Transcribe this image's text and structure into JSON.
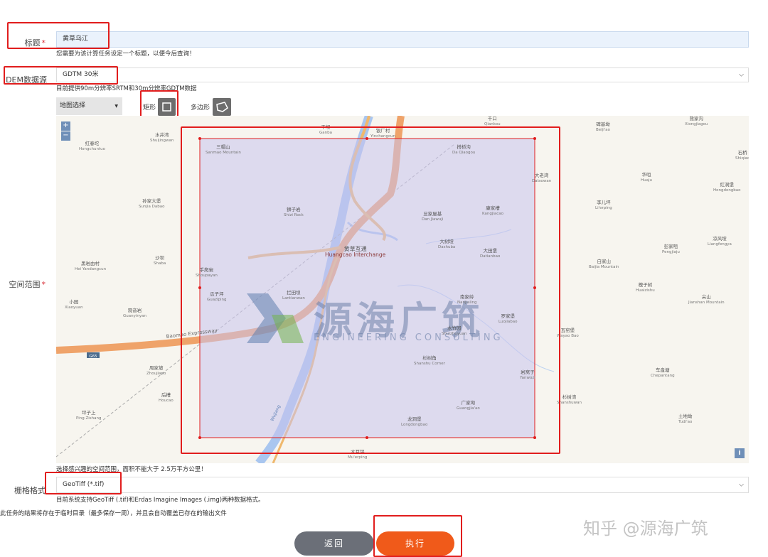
{
  "form": {
    "title": {
      "label": "标题",
      "value": "黄草乌江",
      "hint": "您需要为该计算任务设定一个标题，以便今后查询！"
    },
    "dem": {
      "label": "DEM数据源",
      "value": "GDTM 30米",
      "hint": "目前提供90m分辨率SRTM和30m分辨率GDTM数据"
    },
    "space": {
      "label": "空间范围",
      "hint": "选择感兴趣的空间范围，面积不能大于 2.5万平方公里！"
    },
    "raster": {
      "label": "栅格格式",
      "value": "GeoTiff (*.tif)",
      "hint": "目前系统支持GeoTiff (.tif)和Erdas Imagine Images (.img)两种数据格式。"
    },
    "note": "此任务的结果将存在于临时目录（最多保存一周），并且会自动覆盖已存在的输出文件"
  },
  "map_tools": {
    "basemap_select": "地图选择",
    "rect_label": "矩形",
    "polygon_label": "多边形",
    "zoom_in": "+",
    "zoom_out": "−",
    "info": "i"
  },
  "map_places": [
    {
      "zh": "干坝",
      "en": "Ganba"
    },
    {
      "zh": "银厂村",
      "en": "Yinchangcun"
    },
    {
      "zh": "千口",
      "en": "Qiankou"
    },
    {
      "zh": "碑基坳",
      "en": "Beiji'ao"
    },
    {
      "zh": "熊家沟",
      "en": "Xiongjiagou"
    },
    {
      "zh": "石桥",
      "en": "Shiqiao"
    },
    {
      "zh": "红春坨",
      "en": "Hongchuntuo"
    },
    {
      "zh": "水井湾",
      "en": "Shuijingwan"
    },
    {
      "zh": "三帽山",
      "en": "Sanmao Mountain"
    },
    {
      "zh": "搭桥沟",
      "en": "Da Qiaogou"
    },
    {
      "zh": "大老湾",
      "en": "Dalaowan"
    },
    {
      "zh": "华咀",
      "en": "Huaju"
    },
    {
      "zh": "红洞堡",
      "en": "Hongdongbao"
    },
    {
      "zh": "孙家大堡",
      "en": "Sunjia Dabao"
    },
    {
      "zh": "狮子岩",
      "en": "Shizi Rock"
    },
    {
      "zh": "旦家屋基",
      "en": "Dan Jiawuji"
    },
    {
      "zh": "康家槽",
      "en": "Kangjiacao"
    },
    {
      "zh": "李儿坪",
      "en": "Li'erping"
    },
    {
      "zh": "黄草互通",
      "en": "Huangcao Interchange"
    },
    {
      "zh": "大树垭",
      "en": "Dashuba"
    },
    {
      "zh": "大田堡",
      "en": "Datianbao"
    },
    {
      "zh": "彭家咀",
      "en": "Pengjiaju"
    },
    {
      "zh": "凉风垭",
      "en": "Liangfengya"
    },
    {
      "zh": "黑岩由村",
      "en": "Hei Yandangcun"
    },
    {
      "zh": "沙坝",
      "en": "Shaba"
    },
    {
      "zh": "手爬岩",
      "en": "Shoupayan"
    },
    {
      "zh": "白家山",
      "en": "Baijia Mountain"
    },
    {
      "zh": "瓜子坪",
      "en": "Guaziping"
    },
    {
      "zh": "拦田坝",
      "en": "Lantianwan"
    },
    {
      "zh": "槐子树",
      "en": "Huaizishu"
    },
    {
      "zh": "尖山",
      "en": "Jianshan Mountain"
    },
    {
      "zh": "小园",
      "en": "Xiaoyuan"
    },
    {
      "zh": "观音岩",
      "en": "Guanyinyan"
    },
    {
      "zh": "南家岭",
      "en": "Nanjialing"
    },
    {
      "zh": "罗家堡",
      "en": "Luojiabao"
    },
    {
      "zh": "瓦窑堡",
      "en": "Wayao Bao"
    },
    {
      "zh": "水竹园",
      "en": "Shuizhuyuan"
    },
    {
      "zh": "杉树角",
      "en": "Shanshu Corner"
    },
    {
      "zh": "周家坡",
      "en": "Zhoujiapo"
    },
    {
      "zh": "岩窝子",
      "en": "Yanwozi"
    },
    {
      "zh": "车盘塘",
      "en": "Chepantang"
    },
    {
      "zh": "后槽",
      "en": "Houcao"
    },
    {
      "zh": "杉树湾",
      "en": "Shanshuwan"
    },
    {
      "zh": "广家坳",
      "en": "Guangjia'ao"
    },
    {
      "zh": "坪子上",
      "en": "Ping Zishang"
    },
    {
      "zh": "龙洞堡",
      "en": "Longdongbao"
    },
    {
      "zh": "土地坳",
      "en": "Tudi'ao"
    },
    {
      "zh": "木耳坪",
      "en": "Mu'erping"
    }
  ],
  "map_road": {
    "expressway": "Baomao Expressway",
    "shield": "G65",
    "river": "Wujiang"
  },
  "watermark": {
    "cn": "源海广筑",
    "en": "ENGINEERING CONSULTING"
  },
  "footer_watermark": "知乎 @源海广筑",
  "buttons": {
    "back": "返回",
    "run": "执行"
  },
  "colors": {
    "accent_run": "#f05a1a",
    "back": "#6b6f78",
    "highlight": "#e11d1d",
    "selection": "#c9c2ec"
  }
}
